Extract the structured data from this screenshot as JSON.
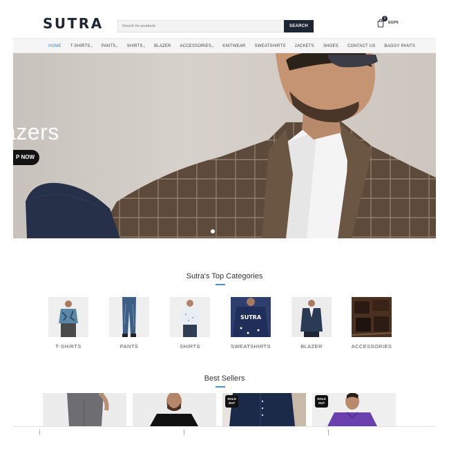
{
  "header": {
    "logo": "SUTRA",
    "search": {
      "placeholder": "Search for products",
      "button_label": "SEARCH"
    },
    "cart": {
      "count": "0",
      "total": "EGP0"
    }
  },
  "nav": {
    "items": [
      {
        "label": "HOME",
        "active": true,
        "has_dropdown": false
      },
      {
        "label": "T-SHIRTS",
        "active": false,
        "has_dropdown": true
      },
      {
        "label": "PANTS",
        "active": false,
        "has_dropdown": true
      },
      {
        "label": "SHIRTS",
        "active": false,
        "has_dropdown": true
      },
      {
        "label": "BLAZER",
        "active": false,
        "has_dropdown": false
      },
      {
        "label": "ACCESSORIES",
        "active": false,
        "has_dropdown": true
      },
      {
        "label": "KNITWEAR",
        "active": false,
        "has_dropdown": false
      },
      {
        "label": "SWEATSHIRTS",
        "active": false,
        "has_dropdown": false
      },
      {
        "label": "JACKETS",
        "active": false,
        "has_dropdown": false
      },
      {
        "label": "SHOES",
        "active": false,
        "has_dropdown": false
      },
      {
        "label": "CONTACT US",
        "active": false,
        "has_dropdown": false
      },
      {
        "label": "BAGGY PANTS",
        "active": false,
        "has_dropdown": false
      }
    ],
    "dropdown_icon": "chevron-down-icon"
  },
  "hero": {
    "title": "azers",
    "button_label": "P NOW",
    "slide_dots": 1
  },
  "categories": {
    "title": "Sutra's Top Categories",
    "items": [
      {
        "label": "T-SHIRTS"
      },
      {
        "label": "PANTS"
      },
      {
        "label": "SHIRTS"
      },
      {
        "label": "SWEATSHIRTS",
        "print": "SUTRA"
      },
      {
        "label": "BLAZER"
      },
      {
        "label": "ACCESSORIES"
      }
    ]
  },
  "best_sellers": {
    "title": "Best Sellers",
    "products": [
      {
        "sold_out": false
      },
      {
        "sold_out": false
      },
      {
        "sold_out": true,
        "badge_line1": "SOLD",
        "badge_line2": "OUT"
      },
      {
        "sold_out": true,
        "badge_line1": "SOLD",
        "badge_line2": "OUT"
      }
    ]
  },
  "colors": {
    "brand_dark": "#1c2733",
    "nav_active": "#3b80d6",
    "underline": "#4a90d9"
  }
}
